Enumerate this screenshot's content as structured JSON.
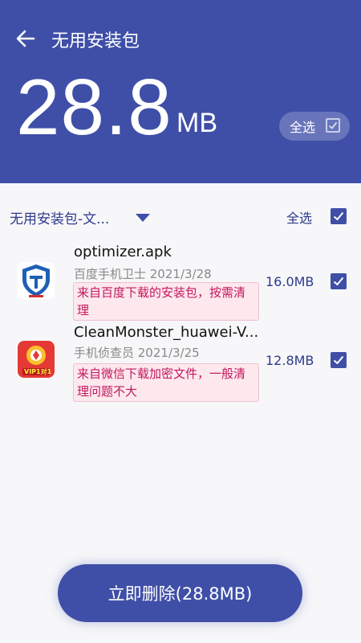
{
  "header": {
    "title": "无用安装包",
    "total_size_value": "28.8",
    "total_size_unit": "MB",
    "select_all_label": "全选"
  },
  "filter": {
    "category_label": "无用安装包-文...",
    "select_all_label": "全选"
  },
  "items": [
    {
      "name": "optimizer.apk",
      "meta": "百度手机卫士 2021/3/28",
      "note": "来自百度下载的安装包，按需清理",
      "size": "16.0MB",
      "checked": true
    },
    {
      "name": "CleanMonster_huawei-V...",
      "meta": "手机侦查员 2021/3/25",
      "note": "来自微信下载加密文件，一般清理问题不大",
      "size": "12.8MB",
      "checked": true,
      "icon_badge": "VIP1对1"
    }
  ],
  "action": {
    "delete_label": "立即删除(28.8MB)"
  },
  "colors": {
    "primary": "#3f4fa8",
    "note_bg": "#fde8ee",
    "note_text": "#c2185b"
  }
}
